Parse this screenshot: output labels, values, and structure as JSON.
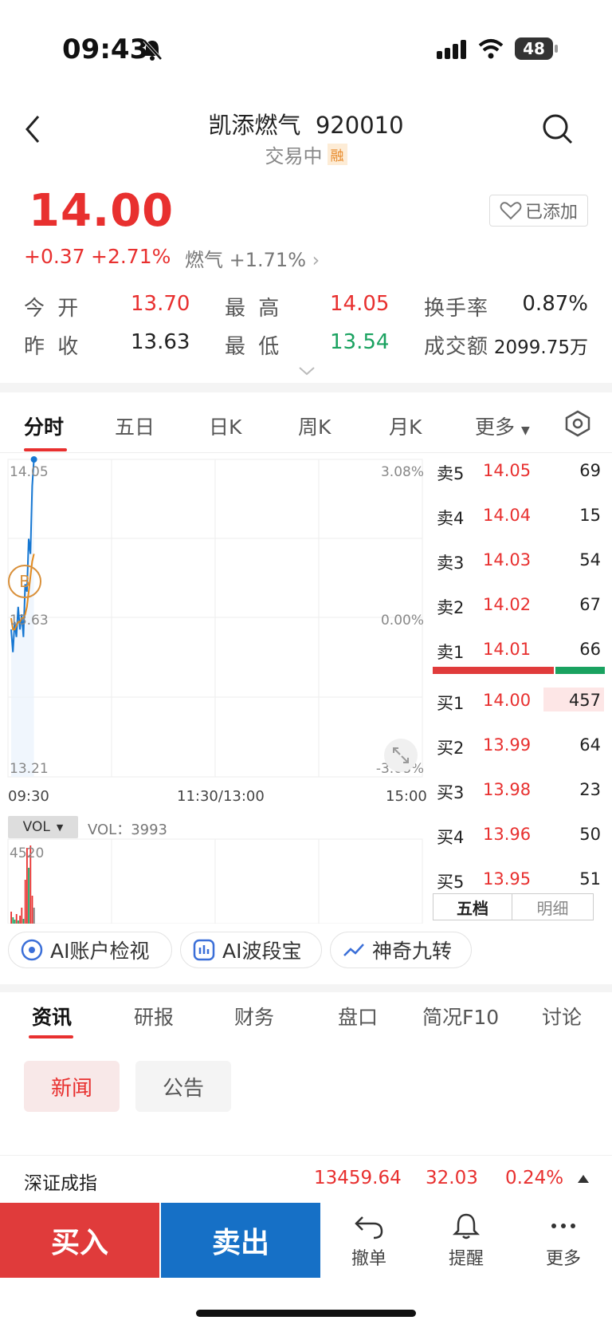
{
  "status": {
    "time": "09:43",
    "battery": "48"
  },
  "header": {
    "name": "凯添燃气",
    "code": "920010",
    "status": "交易中",
    "badge": "融"
  },
  "quote": {
    "price": "14.00",
    "change": "+0.37",
    "change_pct": "+2.71%",
    "sector": "燃气",
    "sector_pct": "+1.71%",
    "added_label": "已添加",
    "stats": [
      {
        "label": "今 开",
        "value": "13.70",
        "color": "red"
      },
      {
        "label": "最 高",
        "value": "14.05",
        "color": "red"
      },
      {
        "label": "换手率",
        "value": "0.87%",
        "color": "black"
      },
      {
        "label": "昨 收",
        "value": "13.63",
        "color": "black"
      },
      {
        "label": "最 低",
        "value": "13.54",
        "color": "green"
      },
      {
        "label": "成交额",
        "value": "2099.75万",
        "color": "black"
      }
    ]
  },
  "chart_tabs": [
    "分时",
    "五日",
    "日K",
    "周K",
    "月K",
    "更多"
  ],
  "chart": {
    "y_top": "14.05",
    "y_mid": "13.63",
    "y_bottom": "13.21",
    "pct_top": "3.08%",
    "pct_mid": "0.00%",
    "pct_bottom": "-3.08%",
    "x_labels": [
      "09:30",
      "11:30/13:00",
      "15:00"
    ],
    "marker": "B",
    "vol_selector": "VOL",
    "vol_readout": "VOL：3993",
    "vol_max": "4520"
  },
  "chart_data": {
    "type": "line",
    "x": [
      "09:30",
      "09:31",
      "09:32",
      "09:33",
      "09:34",
      "09:35",
      "09:36",
      "09:37",
      "09:38",
      "09:39",
      "09:40",
      "09:41",
      "09:42",
      "09:43"
    ],
    "series": [
      {
        "values": [
          13.6,
          13.54,
          13.62,
          13.58,
          13.66,
          13.6,
          13.64,
          13.58,
          13.72,
          13.7,
          13.84,
          13.8,
          13.98,
          14.05
        ]
      },
      {
        "values": [
          13.63,
          13.6,
          13.6,
          13.61,
          13.62,
          13.62,
          13.63,
          13.63,
          13.64,
          13.66,
          13.7,
          13.74,
          13.78,
          13.8
        ]
      }
    ],
    "ylim": [
      13.21,
      14.05
    ]
  },
  "orderbook": {
    "sells": [
      {
        "label": "卖5",
        "price": "14.05",
        "vol": "69"
      },
      {
        "label": "卖4",
        "price": "14.04",
        "vol": "15"
      },
      {
        "label": "卖3",
        "price": "14.03",
        "vol": "54"
      },
      {
        "label": "卖2",
        "price": "14.02",
        "vol": "67"
      },
      {
        "label": "卖1",
        "price": "14.01",
        "vol": "66"
      }
    ],
    "buys": [
      {
        "label": "买1",
        "price": "14.00",
        "vol": "457"
      },
      {
        "label": "买2",
        "price": "13.99",
        "vol": "64"
      },
      {
        "label": "买3",
        "price": "13.98",
        "vol": "23"
      },
      {
        "label": "买4",
        "price": "13.96",
        "vol": "50"
      },
      {
        "label": "买5",
        "price": "13.95",
        "vol": "51"
      }
    ],
    "tabs": [
      "五档",
      "明细"
    ]
  },
  "ai_chips": [
    "AI账户检视",
    "AI波段宝",
    "神奇九转"
  ],
  "info_tabs": [
    "资讯",
    "研报",
    "财务",
    "盘口",
    "简况F10",
    "讨论"
  ],
  "info_pills": [
    "新闻",
    "公告"
  ],
  "ticker": {
    "name": "深证成指",
    "value": "13459.64",
    "change": "32.03",
    "pct": "0.24%"
  },
  "bottom": {
    "buy": "买入",
    "sell": "卖出",
    "actions": [
      "撤单",
      "提醒",
      "更多"
    ]
  }
}
